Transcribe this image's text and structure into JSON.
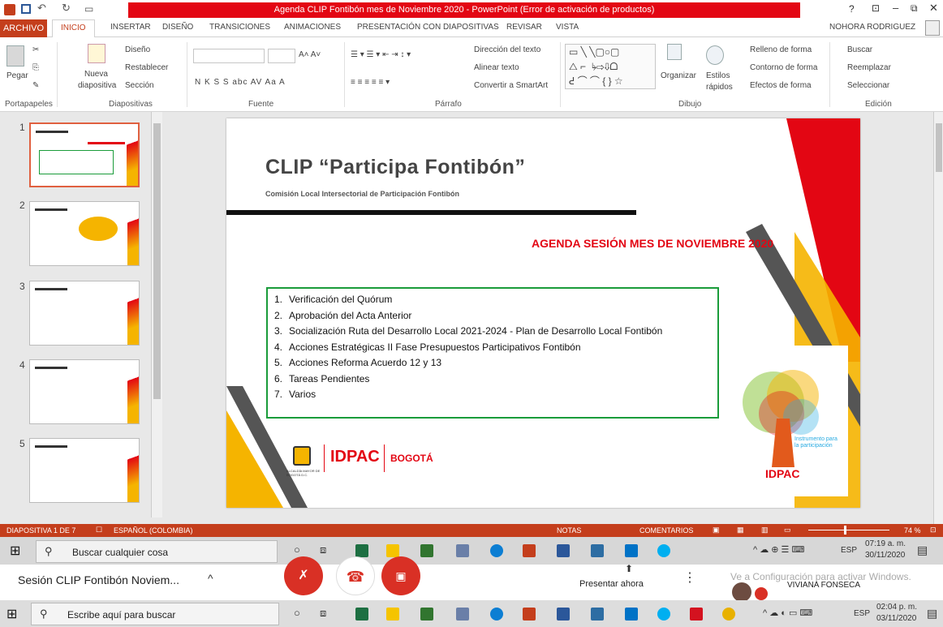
{
  "window": {
    "title": "Agenda CLIP Fontibón mes de Noviembre 2020 -  PowerPoint (Error de activación de productos)",
    "user": "NOHORA RODRIGUEZ",
    "help": "?"
  },
  "tabs": [
    "ARCHIVO",
    "INICIO",
    "INSERTAR",
    "DISEÑO",
    "TRANSICIONES",
    "ANIMACIONES",
    "PRESENTACIÓN CON DIAPOSITIVAS",
    "REVISAR",
    "VISTA"
  ],
  "ribbon": {
    "pegar": "Pegar",
    "nueva": "Nueva",
    "diapositiva": "diapositiva",
    "diseno": "Diseño",
    "restablecer": "Restablecer",
    "seccion": "Sección",
    "fuente_btns": "N  K  S  S  abc  AV  Aa   A",
    "direccion": "Dirección del texto",
    "alinear": "Alinear texto",
    "convertir": "Convertir a SmartArt",
    "organizar": "Organizar",
    "estilos": "Estilos",
    "rapidos": "rápidos",
    "relleno": "Relleno de forma",
    "contorno": "Contorno de forma",
    "efectos": "Efectos de forma",
    "buscar": "Buscar",
    "reemplazar": "Reemplazar",
    "seleccionar": "Seleccionar",
    "groups": [
      "Portapapeles",
      "Diapositivas",
      "Fuente",
      "Párrafo",
      "Dibujo",
      "Edición"
    ]
  },
  "thumbs": [
    "1",
    "2",
    "3",
    "4",
    "5"
  ],
  "slide": {
    "title": "CLIP “Participa Fontibón”",
    "subtitle": "Comisión Local Intersectorial de Participación Fontibón",
    "agenda_title": "AGENDA SESIÓN MES DE NOVIEMBRE 2020",
    "items": [
      "Verificación del Quórum",
      "Aprobación del Acta Anterior",
      "Socialización Ruta del Desarrollo Local 2021-2024  - Plan de Desarrollo Local  Fontibón",
      "Acciones Estratégicas II Fase Presupuestos Participativos Fontibón",
      "Acciones Reforma Acuerdo 12 y 13",
      "Tareas Pendientes",
      "Varios"
    ],
    "nums": [
      "1.",
      "2.",
      "3.",
      "4.",
      "5.",
      "6.",
      "7."
    ],
    "logo_idpac": "IDPAC",
    "logo_bogota": "BOGOTÁ",
    "alcaldia": "ALCALDÍA MAYOR DE BOGOTÁ D.C.",
    "poster_text": "Instrumento para la participación",
    "poster_brand": "IDPAC"
  },
  "status": {
    "slide": "DIAPOSITIVA 1 DE 7",
    "lang": "ESPAÑOL (COLOMBIA)",
    "notas": "NOTAS",
    "comentarios": "COMENTARIOS",
    "zoom": "74 %"
  },
  "taskbar1": {
    "search": "Buscar cualquier cosa",
    "time": "07:19 a. m.",
    "date": "30/11/2020",
    "lang": "ESP"
  },
  "meet": {
    "title": "Sesión CLIP Fontibón Noviem...",
    "present": "Presentar ahora",
    "activate": "Ve a Configuración para activar Windows.",
    "user": "VIVIANA FONSECA"
  },
  "taskbar2": {
    "search": "Escribe aquí para buscar",
    "time": "02:04 p. m.",
    "date": "03/11/2020",
    "lang": "ESP"
  },
  "colors": {
    "accent": "#c43e1c",
    "title_red": "#e30613",
    "slide_red": "#e30613",
    "box_green": "#1a9c3a",
    "yellow": "#f5b400"
  }
}
